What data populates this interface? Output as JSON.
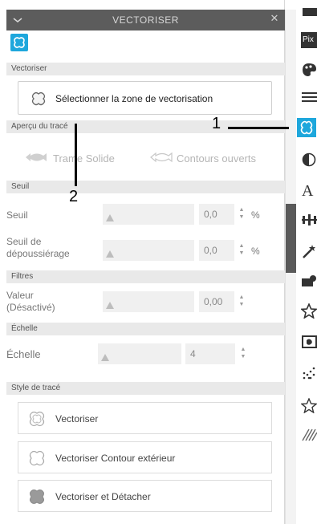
{
  "window": {
    "title": "VECTORISER"
  },
  "sections": {
    "vectoriser": "Vectoriser",
    "apercu": "Aperçu du tracé",
    "seuil": "Seuil",
    "filtres": "Filtres",
    "echelle": "Échelle",
    "style": "Style de tracé"
  },
  "buttons": {
    "select_zone": "Sélectionner la zone de vectorisation",
    "trame_solide": "Trame Solide",
    "contours_ouverts": "Contours ouverts"
  },
  "seuil": {
    "seuil_label": "Seuil",
    "seuil_value": "0,0",
    "seuil_unit": "%",
    "depous_label_1": "Seuil de",
    "depous_label_2": "dépoussiérage",
    "depous_value": "0,0",
    "depous_unit": "%"
  },
  "filtres": {
    "valeur_label_1": "Valeur",
    "valeur_label_2": "(Désactivé)",
    "valeur_value": "0,00"
  },
  "echelle": {
    "label": "Échelle",
    "value": "4"
  },
  "style": {
    "vectoriser": "Vectoriser",
    "contour": "Vectoriser Contour extérieur",
    "detacher": "Vectoriser et Détacher"
  },
  "annotations": {
    "one": "1",
    "two": "2"
  },
  "rightbar": {
    "pix_label": "Pix",
    "letter_a": "A"
  },
  "colors": {
    "accent": "#1ea7dc",
    "title_bar": "#5c5c5c"
  }
}
